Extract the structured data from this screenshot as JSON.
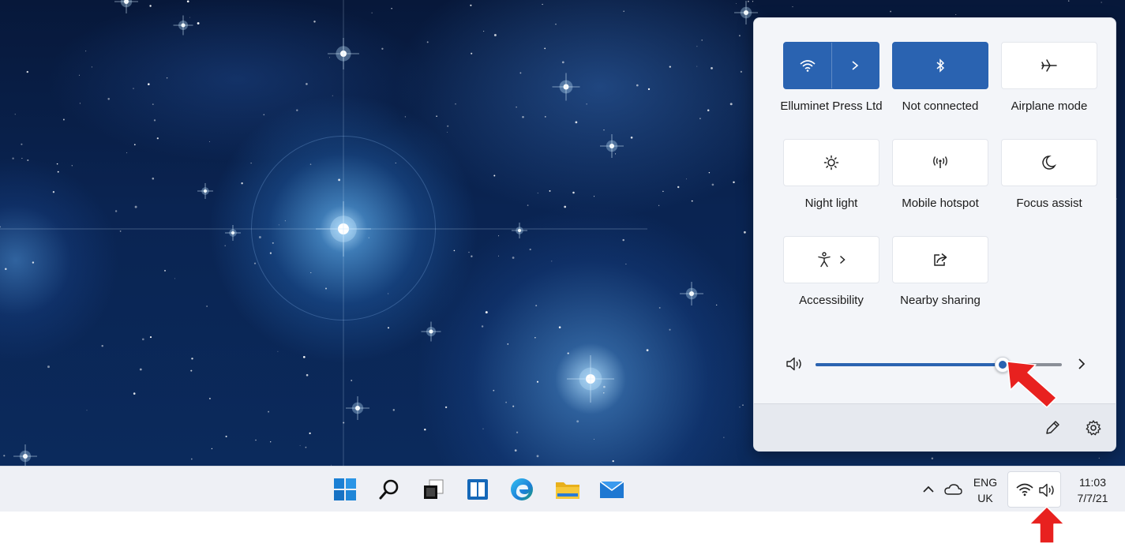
{
  "quick_settings": {
    "tiles": [
      {
        "id": "wifi",
        "label": "Elluminet Press Ltd",
        "icon": "wifi-icon",
        "active": true,
        "has_chevron": true
      },
      {
        "id": "bluetooth",
        "label": "Not connected",
        "icon": "bluetooth-icon",
        "active": true,
        "has_chevron": false
      },
      {
        "id": "airplane",
        "label": "Airplane mode",
        "icon": "airplane-icon",
        "active": false,
        "has_chevron": false
      },
      {
        "id": "night-light",
        "label": "Night light",
        "icon": "brightness-icon",
        "active": false,
        "has_chevron": false
      },
      {
        "id": "mobile-hotspot",
        "label": "Mobile hotspot",
        "icon": "hotspot-icon",
        "active": false,
        "has_chevron": false
      },
      {
        "id": "focus-assist",
        "label": "Focus assist",
        "icon": "moon-icon",
        "active": false,
        "has_chevron": false
      },
      {
        "id": "accessibility",
        "label": "Accessibility",
        "icon": "accessibility-icon",
        "active": false,
        "has_chevron": true
      },
      {
        "id": "nearby-sharing",
        "label": "Nearby sharing",
        "icon": "share-icon",
        "active": false,
        "has_chevron": false
      }
    ],
    "volume": {
      "level_fraction": 0.76,
      "icon": "speaker-icon"
    },
    "footer": {
      "edit_icon": "pencil-icon",
      "settings_icon": "gear-icon"
    }
  },
  "taskbar": {
    "apps": [
      "start-icon",
      "search-icon",
      "task-view-icon",
      "widgets-icon",
      "edge-icon",
      "file-explorer-icon",
      "mail-icon"
    ],
    "tray": {
      "language_line1": "ENG",
      "language_line2": "UK",
      "time": "11:03",
      "date": "7/7/21"
    }
  },
  "colors": {
    "accent": "#2a63b1",
    "annotation_arrow": "#e8211f"
  }
}
